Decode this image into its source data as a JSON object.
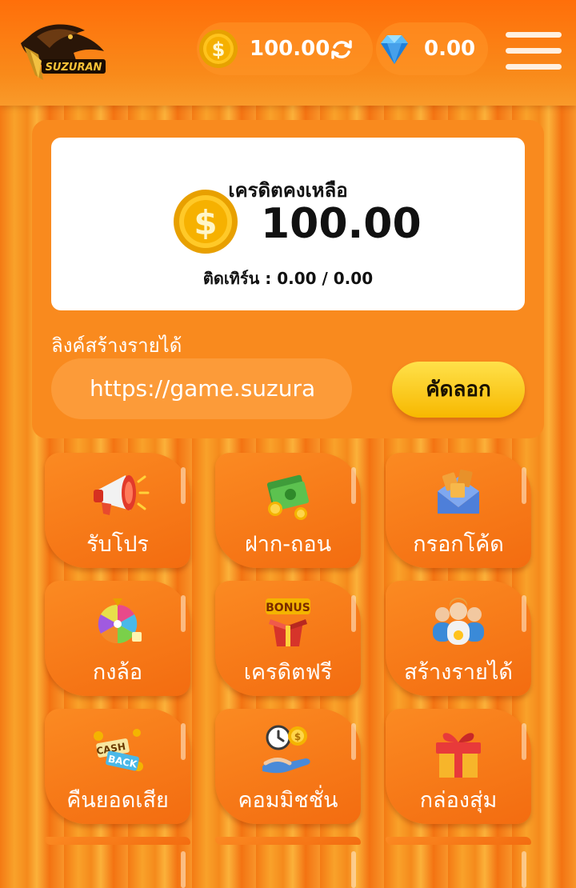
{
  "header": {
    "logo_text": "SUZURAN",
    "coin_balance": "100.00",
    "gem_balance": "0.00"
  },
  "credit": {
    "title": "เครดิตคงเหลือ",
    "amount": "100.00",
    "turnover": "ติดเทิร์น : 0.00 / 0.00"
  },
  "referral": {
    "label": "ลิงค์สร้างรายได้",
    "link": "https://game.suzura",
    "copy_label": "คัดลอก"
  },
  "menu_tiles": [
    {
      "label": "รับโปร",
      "icon": "megaphone-icon"
    },
    {
      "label": "ฝาก-ถอน",
      "icon": "money-stack-icon"
    },
    {
      "label": "กรอกโค้ด",
      "icon": "code-envelope-icon"
    },
    {
      "label": "กงล้อ",
      "icon": "wheel-icon"
    },
    {
      "label": "เครดิตฟรี",
      "icon": "bonus-box-icon"
    },
    {
      "label": "สร้างรายได้",
      "icon": "team-icon"
    },
    {
      "label": "คืนยอดเสีย",
      "icon": "cashback-icon"
    },
    {
      "label": "คอมมิชชั่น",
      "icon": "commission-icon"
    },
    {
      "label": "กล่องสุ่ม",
      "icon": "gift-box-icon"
    }
  ],
  "colors": {
    "header_orange": "#ff6f0a",
    "panel_orange": "#f98a1e",
    "button_yellow": "#ffd21a"
  }
}
